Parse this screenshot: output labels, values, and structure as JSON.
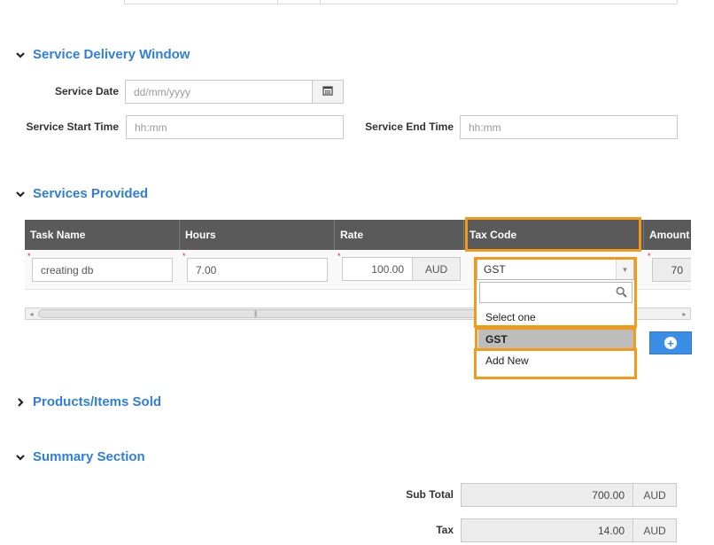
{
  "sections": {
    "service_delivery": {
      "title": "Service Delivery Window"
    },
    "services_provided": {
      "title": "Services Provided"
    },
    "products": {
      "title": "Products/Items Sold"
    },
    "summary": {
      "title": "Summary Section"
    }
  },
  "service_delivery": {
    "service_date_label": "Service Date",
    "service_date_placeholder": "dd/mm/yyyy",
    "start_time_label": "Service Start Time",
    "start_time_placeholder": "hh:mm",
    "end_time_label": "Service End Time",
    "end_time_placeholder": "hh:mm"
  },
  "grid": {
    "columns": [
      "Task Name",
      "Hours",
      "Rate",
      "Tax Code",
      "Amount"
    ],
    "row": {
      "task_name": "creating db",
      "hours": "7.00",
      "rate": "100.00",
      "rate_currency": "AUD",
      "tax_code": "GST",
      "amount_partial": "70"
    }
  },
  "tax_dropdown": {
    "selected": "GST",
    "search_value": "",
    "options": [
      "Select one",
      "GST",
      "Add New"
    ],
    "highlighted_option": "GST"
  },
  "summary": {
    "subtotal_label": "Sub Total",
    "subtotal_value": "700.00",
    "subtotal_currency": "AUD",
    "tax_label": "Tax",
    "tax_value": "14.00",
    "tax_currency": "AUD"
  },
  "colors": {
    "section_title": "#2f7fd8",
    "grid_header": "#5a5a5a",
    "highlight": "#f39a1b",
    "add_button": "#3a8ee6",
    "required_marker": "#d9242a"
  },
  "icons": {
    "chevron_down": "chevron-down-icon",
    "chevron_right": "chevron-right-icon",
    "calendar": "calendar-icon",
    "search": "search-icon",
    "plus": "plus-circle-icon"
  }
}
